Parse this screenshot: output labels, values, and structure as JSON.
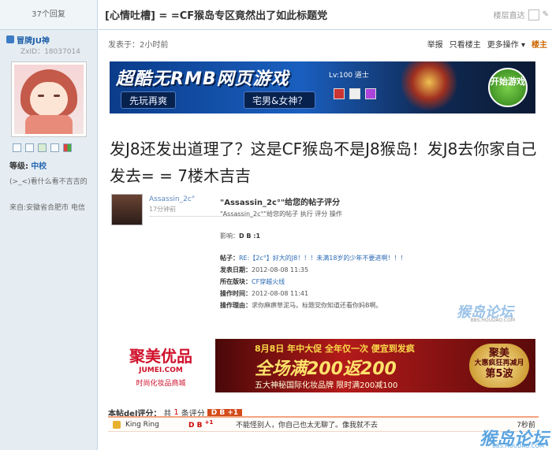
{
  "left": {
    "reply_count": "37个回复",
    "author": "冒牌JU神",
    "uid": "ZxID：18037014",
    "level_label": "等级:",
    "level_value": "中校",
    "signature": "(>_<)看什么看不吉吉的",
    "from": "来自:安徽省合肥市 电信"
  },
  "header": {
    "title": "[心情吐槽] = =CF猴岛专区竟然出了如此标题党",
    "floor_jump": "楼层直达"
  },
  "meta": {
    "posted": "发表于：2小时前",
    "report": "举报",
    "only_owner": "只看楼主",
    "more": "更多操作",
    "owner_label": "楼主"
  },
  "banner1": {
    "title": "超酷无RMB网页游戏",
    "sub1": "先玩再爽",
    "sub2": "宅男&女神？",
    "level": "Lv:100 道士",
    "button": "开始游戏"
  },
  "post": {
    "text": "发J8还发出道理了？这是CF猴岛不是J8猴岛！发J8去你家自己发去= = 7楼木吉吉"
  },
  "quote": {
    "user": "Assassin_2c°",
    "time": "17分钟前",
    "heading": "\"Assassin_2c°\"给您的帖子评分",
    "desc": "\"Assassin_2c°\"给您的帖子 执行 评分 操作",
    "effect_label": "影响：",
    "effect_value": "D B :1",
    "thread_label": "帖子：",
    "thread_value": "RE:【2c°】好大的J8！！！未满18岁的少年不要进啊！！！",
    "date_label": "发表日期：",
    "date_value": "2012-08-08 11:35",
    "section_label": "所在版块：",
    "section_value": "CF穿越火线",
    "op_time_label": "操作时间：",
    "op_time_value": "2012-08-08 11:41",
    "reason_label": "操作理由：",
    "reason_value": "求你麻痹草泥马。标题党你知道还看你妈B啊。",
    "watermark": "猴岛论坛",
    "watermark_url": "BBS.HOUDAO.COM"
  },
  "banner2": {
    "logo": "聚美优品",
    "url": "JUMEI.COM",
    "tag": "时尚化妆品商城",
    "date": "8月8日 年中大促 全年仅一次 便宜到发疯",
    "big": "全场满200返200",
    "small": "五大神秘国际化妆品牌 限时满200减100",
    "badge_top": "聚美",
    "badge_mid": "大惠疯狂再减月",
    "badge_bottom": "第5波"
  },
  "rating": {
    "title": "本帖del评分：",
    "total_prefix": "共",
    "total_count": "1",
    "total_suffix": "条评分",
    "tag": "D B +1",
    "row_user": "King Ring",
    "row_score": "D B",
    "row_score_sup": "+1",
    "row_reason": "不能怪别人，你自己也太无聊了。像我就不去",
    "row_more": "7秒前"
  },
  "footer": {
    "watermark": "猴岛论坛",
    "url": "BBS.HOUDAO.COM"
  },
  "colors": {
    "sidebar_bg": "#e5edf2",
    "border": "#c2d5e3",
    "link": "#2a6ab4",
    "rating_tag": "#d24c1b"
  }
}
